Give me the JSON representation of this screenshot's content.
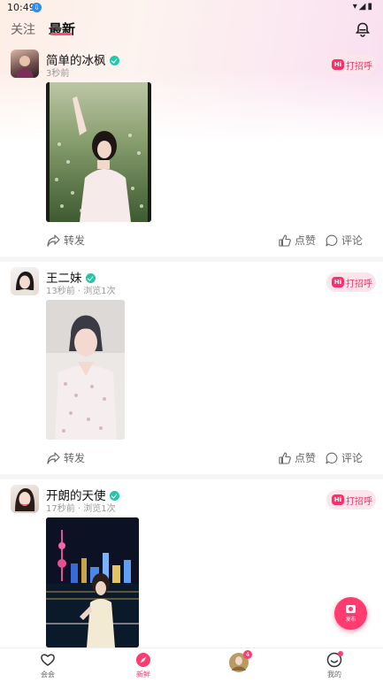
{
  "status_bar": {
    "time": "10:49",
    "download_glyph": "⇩",
    "system_icons": "▾◢▮"
  },
  "tabs": [
    {
      "label": "关注",
      "active": false
    },
    {
      "label": "最新",
      "active": true
    }
  ],
  "posts": [
    {
      "username": "简单的冰枫",
      "meta": "3秒前",
      "greet_hi": "Hi",
      "greet_label": "打招呼",
      "share_label": "转发",
      "like_label": "点赞",
      "comment_label": "评论"
    },
    {
      "username": "王二妹",
      "meta": "13秒前 · 浏览1次",
      "greet_hi": "Hi",
      "greet_label": "打招呼",
      "share_label": "转发",
      "like_label": "点赞",
      "comment_label": "评论"
    },
    {
      "username": "开朗的天使",
      "meta": "17秒前 · 浏览1次",
      "greet_hi": "Hi",
      "greet_label": "打招呼"
    }
  ],
  "fab": {
    "label": "发布"
  },
  "bottom_nav": [
    {
      "label": "会会",
      "icon": "heart-chat-icon"
    },
    {
      "label": "新鲜",
      "icon": "compass-icon",
      "active": true
    },
    {
      "label": "",
      "icon": "avatar",
      "badge": "4"
    },
    {
      "label": "我的",
      "icon": "smile-icon",
      "dot": true
    }
  ],
  "colors": {
    "accent": "#ff3b6f",
    "verify": "#24c6a8",
    "greet_bg": "#fde5ec"
  }
}
